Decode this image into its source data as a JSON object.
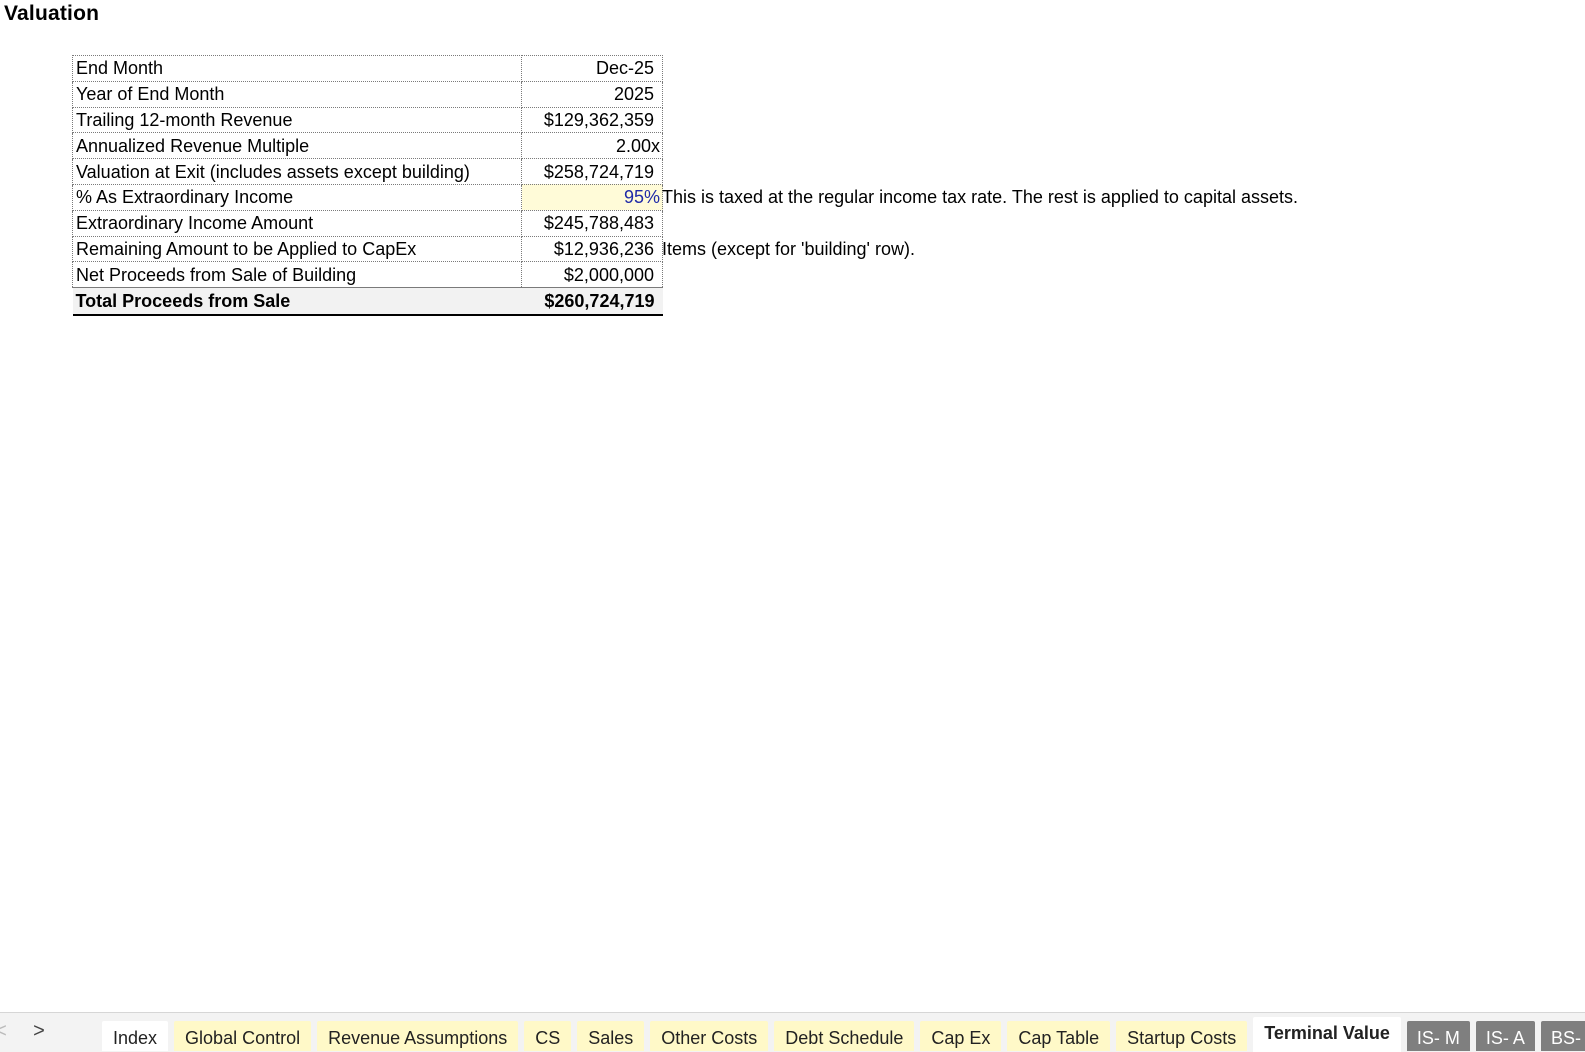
{
  "sheet": {
    "title": "Valuation",
    "rows": [
      {
        "label": "End Month",
        "value": "Dec-25"
      },
      {
        "label": "Year of End Month",
        "value": "2025"
      },
      {
        "label": "Trailing 12-month Revenue",
        "value": "$129,362,359"
      },
      {
        "label": "Annualized Revenue Multiple",
        "value": "2.00x"
      },
      {
        "label": "Valuation at Exit (includes assets except building)",
        "value": "$258,724,719"
      },
      {
        "label": "% As Extraordinary Income",
        "value": "95%"
      },
      {
        "label": "Extraordinary Income Amount",
        "value": "$245,788,483"
      },
      {
        "label": "Remaining Amount to be Applied to CapEx",
        "value": "$12,936,236"
      },
      {
        "label": "Net Proceeds from Sale of Building",
        "value": "$2,000,000"
      }
    ],
    "total": {
      "label": "Total Proceeds from Sale",
      "value": "$260,724,719"
    },
    "notes": {
      "note1": "This is taxed at the regular income tax rate. The rest is applied to capital assets.",
      "note2": "Items (except for 'building' row)."
    },
    "input_cell_color": "#fffbd8",
    "input_text_color": "#1f2aa8"
  },
  "tabbar": {
    "prev_icon": "<",
    "next_icon": ">",
    "tabs": [
      {
        "label": "Index",
        "style": "plain"
      },
      {
        "label": "Global Control",
        "style": "yellow"
      },
      {
        "label": "Revenue Assumptions",
        "style": "yellow"
      },
      {
        "label": "CS",
        "style": "yellow"
      },
      {
        "label": "Sales",
        "style": "yellow"
      },
      {
        "label": "Other Costs",
        "style": "yellow"
      },
      {
        "label": "Debt Schedule",
        "style": "yellow"
      },
      {
        "label": "Cap Ex",
        "style": "yellow"
      },
      {
        "label": "Cap Table",
        "style": "yellow"
      },
      {
        "label": "Startup Costs",
        "style": "yellow"
      },
      {
        "label": "Terminal Value",
        "style": "active"
      },
      {
        "label": "IS- M",
        "style": "gray"
      },
      {
        "label": "IS- A",
        "style": "gray"
      },
      {
        "label": "BS-",
        "style": "gray"
      }
    ],
    "tab_color": "#fff9c8",
    "gray_tab_color": "#7f7f7f"
  }
}
